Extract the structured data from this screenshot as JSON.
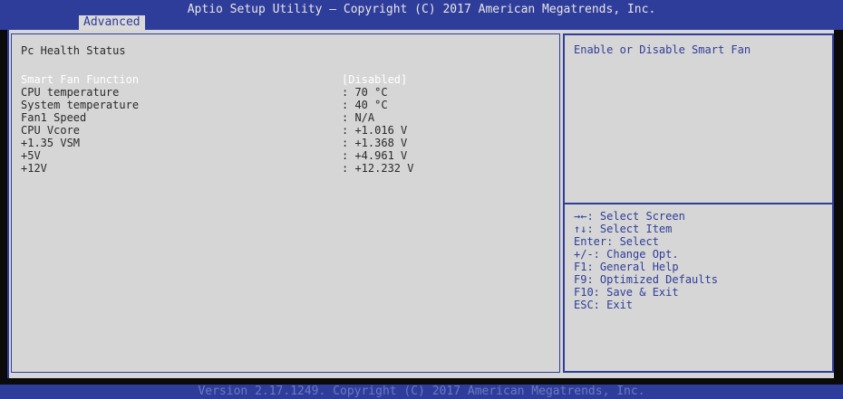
{
  "header": {
    "title": "Aptio Setup Utility – Copyright (C) 2017 American Megatrends, Inc.",
    "active_tab": "Advanced"
  },
  "main": {
    "section_title": "Pc Health Status",
    "items": [
      {
        "label": "Smart Fan Function",
        "value": "[Disabled]"
      },
      {
        "label": "CPU temperature",
        "value": ": 70 °C"
      },
      {
        "label": "System temperature",
        "value": ": 40 °C"
      },
      {
        "label": "Fan1 Speed",
        "value": ": N/A"
      },
      {
        "label": "CPU Vcore",
        "value": ": +1.016 V"
      },
      {
        "label": "+1.35 VSM",
        "value": ": +1.368 V"
      },
      {
        "label": "+5V",
        "value": ": +4.961 V"
      },
      {
        "label": "+12V",
        "value": ": +12.232 V"
      }
    ]
  },
  "help": {
    "text": "Enable or Disable Smart Fan"
  },
  "keys": [
    "→←: Select Screen",
    "↑↓: Select Item",
    "Enter: Select",
    "+/-: Change Opt.",
    "F1: General Help",
    "F9: Optimized Defaults",
    "F10: Save & Exit",
    "ESC: Exit"
  ],
  "footer": {
    "text": "Version 2.17.1249. Copyright (C) 2017 American Megatrends, Inc."
  },
  "colors": {
    "accent_blue": "#2f3d9a",
    "panel_gray": "#d6d6d6",
    "text_dark": "#2a2a2a",
    "highlight_white": "#ffffff"
  }
}
